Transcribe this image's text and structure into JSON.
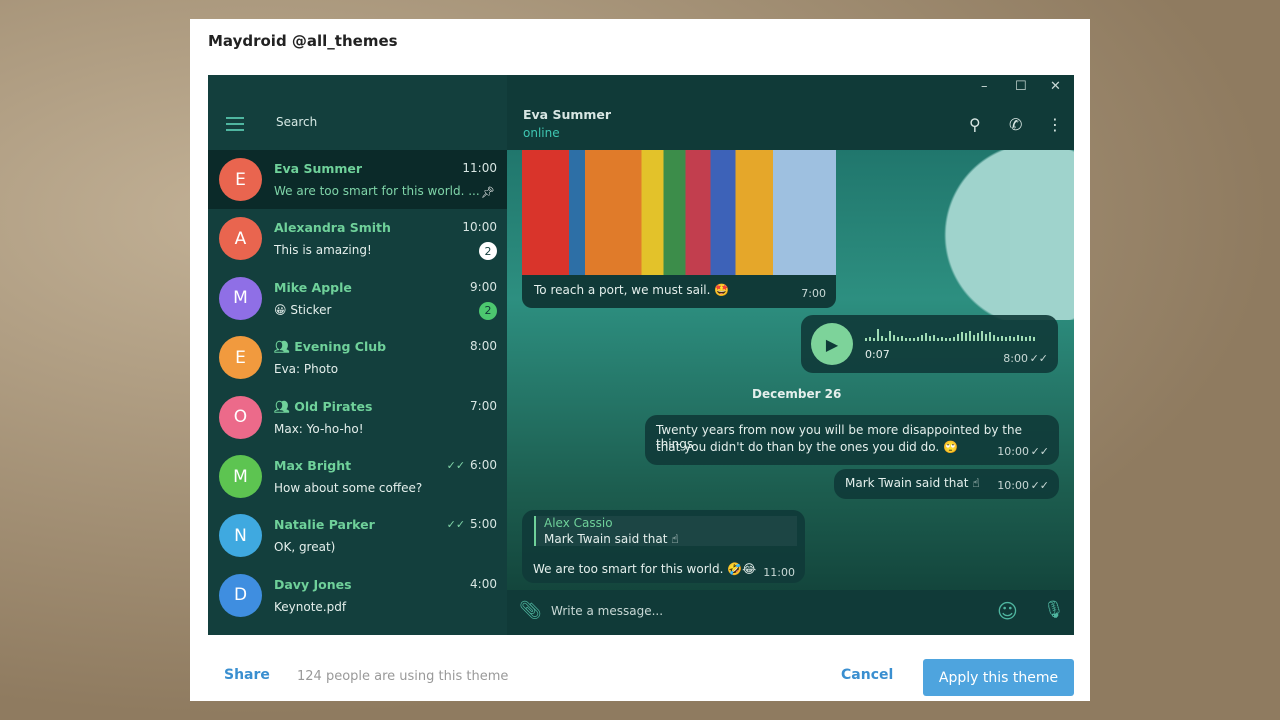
{
  "dialog": {
    "title": "Maydroid @all_themes",
    "share": "Share",
    "users": "124 people are using this theme",
    "cancel": "Cancel",
    "apply": "Apply this theme"
  },
  "sidebar": {
    "search": "Search",
    "chats": [
      {
        "initial": "E",
        "name": "Eva Summer",
        "time": "11:00",
        "preview": "We are too smart for this world. ...",
        "color": "#e9654f",
        "pinned": true
      },
      {
        "initial": "A",
        "name": "Alexandra Smith",
        "time": "10:00",
        "preview": "This is amazing!",
        "color": "#e9654f",
        "badge": "2",
        "badge_color": "#ffffff"
      },
      {
        "initial": "M",
        "name": "Mike Apple",
        "time": "9:00",
        "preview": "😀 Sticker",
        "color": "#8f6fe6",
        "badge": "2",
        "badge_color": "#4cc86f"
      },
      {
        "initial": "E",
        "name": "Evening Club",
        "time": "8:00",
        "preview": "Eva: Photo",
        "color": "#f19a3e",
        "group": true
      },
      {
        "initial": "O",
        "name": "Old Pirates",
        "time": "7:00",
        "preview": "Max: Yo-ho-ho!",
        "color": "#ec6a8a",
        "group": true
      },
      {
        "initial": "M",
        "name": "Max Bright",
        "time": "6:00",
        "preview": "How about some coffee?",
        "color": "#5dc451",
        "read": true
      },
      {
        "initial": "N",
        "name": "Natalie Parker",
        "time": "5:00",
        "preview": "OK, great)",
        "color": "#3fa9e0",
        "read": true
      },
      {
        "initial": "D",
        "name": "Davy Jones",
        "time": "4:00",
        "preview": "Keynote.pdf",
        "color": "#3f8ee0"
      }
    ]
  },
  "chat": {
    "name": "Eva Summer",
    "status": "online",
    "photo_caption": "To reach a port, we must sail. 🤩",
    "photo_time": "7:00",
    "voice_duration": "0:07",
    "voice_time": "8:00",
    "date": "December 26",
    "quote_line1": "Twenty years from now you will be more disappointed by the things",
    "quote_line2": "that you didn't do than by the ones you did do. 🙄",
    "quote_time": "10:00",
    "twain": "Mark Twain said that ☝",
    "twain_time": "10:00",
    "reply_author": "Alex Cassio",
    "reply_text": "Mark Twain said that ☝",
    "reply_msg": "We are too smart for this world. 🤣😂",
    "reply_time": "11:00",
    "input_placeholder": "Write a message..."
  }
}
